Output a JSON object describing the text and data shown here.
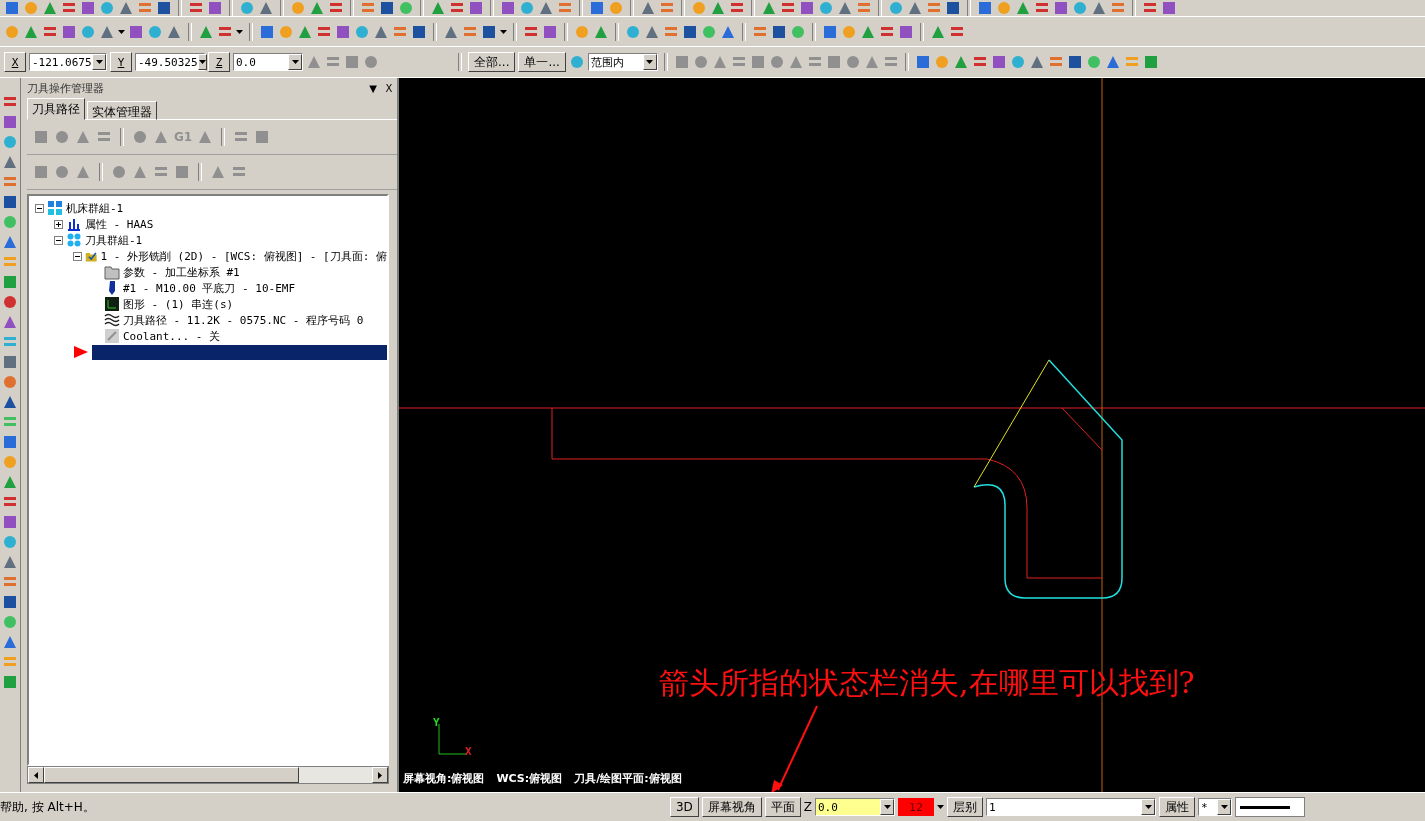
{
  "toolbar": {
    "x_label": "X",
    "x_value": "-121.0675",
    "y_label": "Y",
    "y_value": "-49.50325",
    "z_label": "Z",
    "z_value": "0.0",
    "buttons": [
      "全部...",
      "单一..."
    ],
    "select": "范围内"
  },
  "panel": {
    "title": "刀具操作管理器",
    "menu_glyph": "▼",
    "close_glyph": "X",
    "tabs": [
      {
        "label": "刀具路径",
        "selected": true
      },
      {
        "label": "实体管理器",
        "selected": false
      }
    ],
    "g1_label": "G1",
    "tree": [
      {
        "label": "机床群組-1",
        "kind": "machine",
        "expanded": true,
        "children": [
          {
            "label": "属性 - HAAS",
            "kind": "props",
            "expanded": false
          },
          {
            "label": "刀具群組-1",
            "kind": "group",
            "expanded": true,
            "children": [
              {
                "label": "1 - 外形铣削 (2D) - [WCS: 俯视图] - [刀具面: 俯",
                "kind": "operation",
                "expanded": true,
                "children": [
                  {
                    "label": "参数 - 加工坐标系 #1",
                    "kind": "params"
                  },
                  {
                    "label": "#1 - M10.00 平底刀 - 10-EMF",
                    "kind": "tool"
                  },
                  {
                    "label": "图形 - (1) 串连(s)",
                    "kind": "geometry"
                  },
                  {
                    "label": "刀具路径 - 11.2K - 0575.NC - 程序号码 0",
                    "kind": "toolpath"
                  },
                  {
                    "label": "Coolant... - 关",
                    "kind": "coolant"
                  }
                ]
              }
            ]
          }
        ]
      }
    ],
    "insert_marker": {
      "selected": true
    }
  },
  "viewport": {
    "annotation": "箭头所指的状态栏消失,在哪里可以找到?",
    "axis_y": "Y",
    "axis_x": "X",
    "view_status": [
      "屏幕视角:俯视图",
      "WCS:俯视图",
      "刀具/绘图平面:俯视图"
    ]
  },
  "status_bar": {
    "help": "帮助, 按 Alt+H。",
    "items": [
      {
        "kind": "button",
        "label": "3D"
      },
      {
        "kind": "button",
        "label": "屏幕视角"
      },
      {
        "kind": "button",
        "label": "平面"
      },
      {
        "kind": "label",
        "label": "Z"
      },
      {
        "kind": "zfield",
        "label": "0.0"
      },
      {
        "kind": "swatch",
        "label": "12",
        "color": "#ff0000"
      },
      {
        "kind": "button",
        "label": "层别"
      },
      {
        "kind": "combo",
        "label": "1"
      },
      {
        "kind": "button",
        "label": "属性"
      },
      {
        "kind": "combo",
        "label": "*"
      },
      {
        "kind": "linestyle"
      }
    ]
  }
}
